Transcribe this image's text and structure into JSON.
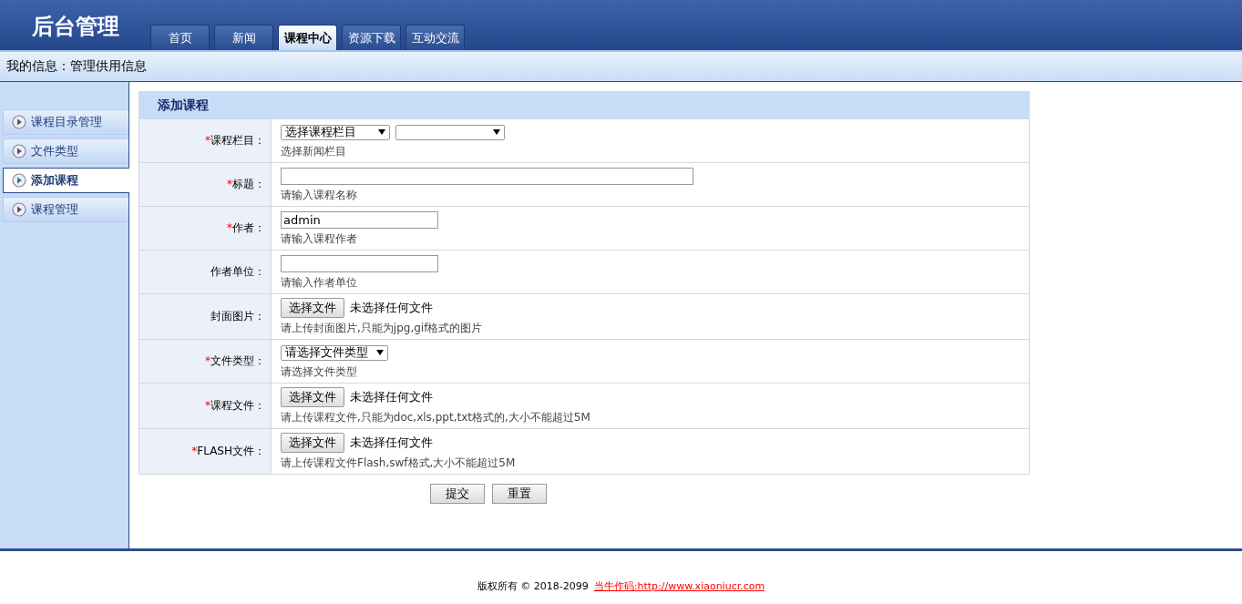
{
  "header": {
    "title": "后台管理"
  },
  "tabs": [
    {
      "label": "首页",
      "selected": false
    },
    {
      "label": "新闻",
      "selected": false
    },
    {
      "label": "课程中心",
      "selected": true
    },
    {
      "label": "资源下载",
      "selected": false
    },
    {
      "label": "互动交流",
      "selected": false
    }
  ],
  "info_bar": {
    "text": "我的信息：管理供用信息"
  },
  "sidebar": {
    "items": [
      {
        "label": "课程目录管理",
        "selected": false
      },
      {
        "label": "文件类型",
        "selected": false
      },
      {
        "label": "添加课程",
        "selected": true
      },
      {
        "label": "课程管理",
        "selected": false
      }
    ]
  },
  "form": {
    "title": "添加课程",
    "rows": [
      {
        "mark": "*",
        "label": "课程栏目：",
        "kind": "double-select",
        "value": "选择课程栏目",
        "hint": "选择新闻栏目"
      },
      {
        "mark": "*",
        "label": "标题：",
        "kind": "text-wide",
        "hint": "请输入课程名称"
      },
      {
        "mark": "*",
        "label": "作者：",
        "kind": "text",
        "value": "admin",
        "hint": "请输入课程作者"
      },
      {
        "label": "作者单位：",
        "kind": "text",
        "hint": "请输入作者单位"
      },
      {
        "label": "封面图片：",
        "kind": "file",
        "button": "选择文件",
        "status": "未选择任何文件",
        "hint": "请上传封面图片,只能为jpg,gif格式的图片"
      },
      {
        "mark": "*",
        "label": "文件类型：",
        "kind": "select",
        "value": "请选择文件类型",
        "hint": "请选择文件类型"
      },
      {
        "mark": "*",
        "label": "课程文件：",
        "kind": "file",
        "button": "选择文件",
        "status": "未选择任何文件",
        "hint": "请上传课程文件,只能为doc,xls,ppt,txt格式的,大小不能超过5M"
      },
      {
        "mark": "*",
        "label": "FLASH文件：",
        "kind": "file",
        "button": "选择文件",
        "status": "未选择任何文件",
        "hint": "请上传课程文件Flash,swf格式,大小不能超过5M"
      }
    ],
    "buttons": [
      "提交",
      "重置"
    ]
  },
  "footer": {
    "text": "版权所有 © 2018-2099",
    "link": "当牛作码:http://www.xiaoniucr.com"
  }
}
